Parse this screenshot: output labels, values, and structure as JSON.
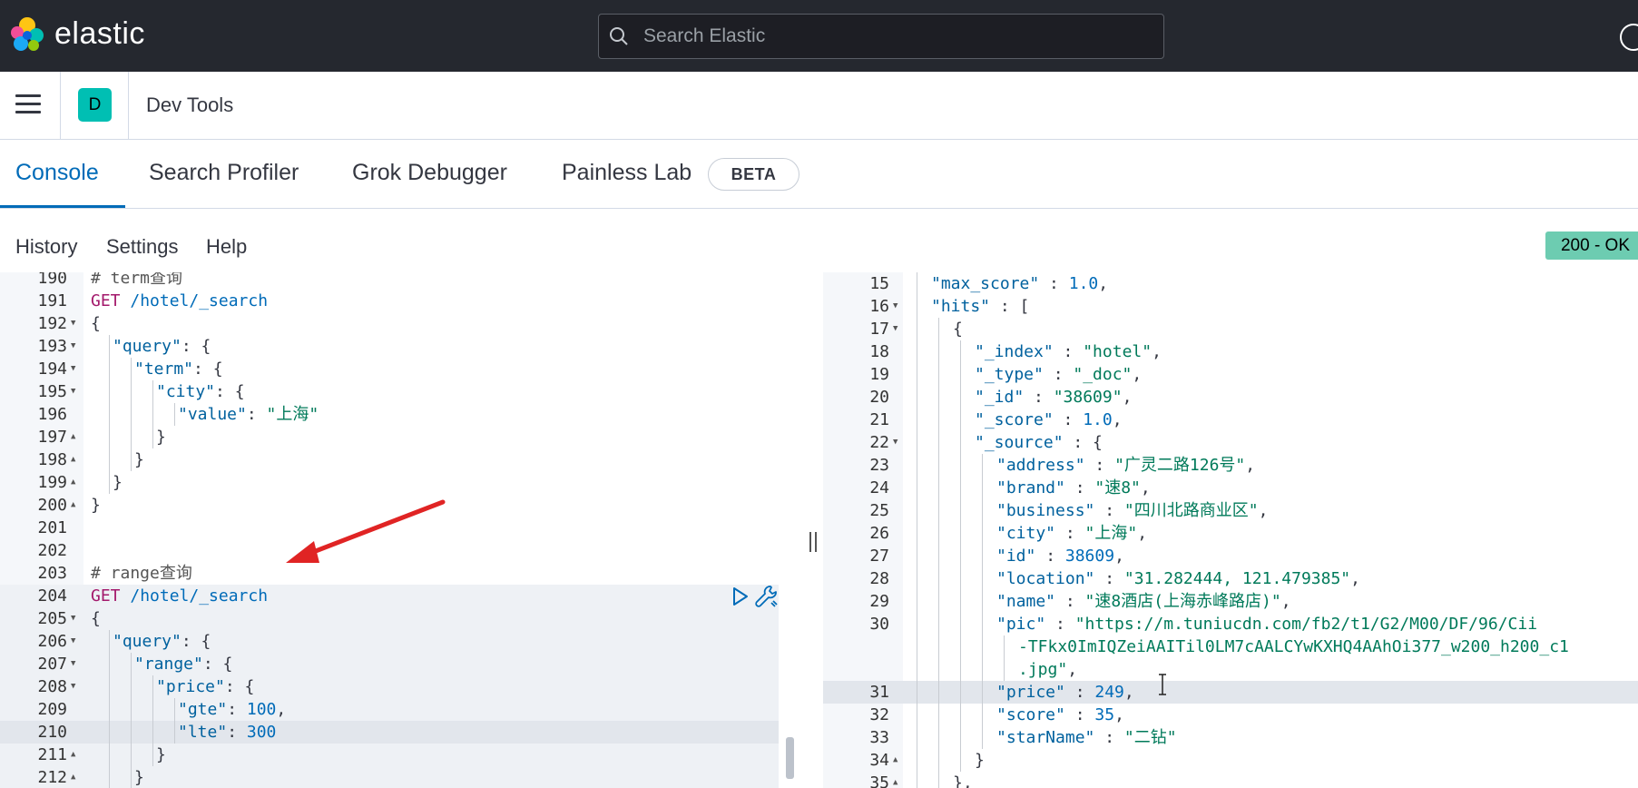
{
  "header": {
    "brand": "elastic",
    "search_placeholder": "Search Elastic",
    "icons": [
      "elastic-logo-icon",
      "search-icon",
      "help-icon"
    ]
  },
  "breadcrumb": {
    "space_initial": "D",
    "title": "Dev Tools",
    "icons": [
      "menu-icon"
    ]
  },
  "tabs": [
    {
      "label": "Console",
      "active": true
    },
    {
      "label": "Search Profiler"
    },
    {
      "label": "Grok Debugger"
    },
    {
      "label": "Painless Lab"
    }
  ],
  "beta_label": "BETA",
  "submenu": [
    "History",
    "Settings",
    "Help"
  ],
  "status": {
    "label": "200 - OK",
    "color": "#6dccb1"
  },
  "colors": {
    "accent": "#006bb8",
    "topbar": "#25282f",
    "space_avatar": "#00bfb3",
    "arrow": "#e02424"
  },
  "request_editor": {
    "lines": [
      {
        "n": "190",
        "fold": "",
        "indent": 0,
        "tokens": [
          {
            "t": "# term查询",
            "c": "comment"
          }
        ]
      },
      {
        "n": "191",
        "fold": "",
        "indent": 0,
        "tokens": [
          {
            "t": "GET",
            "c": "method"
          },
          {
            "t": " /hotel/_search",
            "c": "url"
          }
        ]
      },
      {
        "n": "192",
        "fold": "▼",
        "indent": 0,
        "tokens": [
          {
            "t": "{",
            "c": "punc"
          }
        ]
      },
      {
        "n": "193",
        "fold": "▼",
        "indent": 1,
        "tokens": [
          {
            "t": "\"query\"",
            "c": "key"
          },
          {
            "t": ": {",
            "c": "punc"
          }
        ]
      },
      {
        "n": "194",
        "fold": "▼",
        "indent": 2,
        "tokens": [
          {
            "t": "\"term\"",
            "c": "key"
          },
          {
            "t": ": {",
            "c": "punc"
          }
        ]
      },
      {
        "n": "195",
        "fold": "▼",
        "indent": 3,
        "tokens": [
          {
            "t": "\"city\"",
            "c": "key"
          },
          {
            "t": ": {",
            "c": "punc"
          }
        ]
      },
      {
        "n": "196",
        "fold": "",
        "indent": 4,
        "tokens": [
          {
            "t": "\"value\"",
            "c": "key"
          },
          {
            "t": ": ",
            "c": "punc"
          },
          {
            "t": "\"上海\"",
            "c": "str"
          }
        ]
      },
      {
        "n": "197",
        "fold": "▲",
        "indent": 3,
        "tokens": [
          {
            "t": "}",
            "c": "punc"
          }
        ]
      },
      {
        "n": "198",
        "fold": "▲",
        "indent": 2,
        "tokens": [
          {
            "t": "}",
            "c": "punc"
          }
        ]
      },
      {
        "n": "199",
        "fold": "▲",
        "indent": 1,
        "tokens": [
          {
            "t": "}",
            "c": "punc"
          }
        ]
      },
      {
        "n": "200",
        "fold": "▲",
        "indent": 0,
        "tokens": [
          {
            "t": "}",
            "c": "punc"
          }
        ]
      },
      {
        "n": "201",
        "fold": "",
        "indent": 0,
        "tokens": []
      },
      {
        "n": "202",
        "fold": "",
        "indent": 0,
        "tokens": []
      },
      {
        "n": "203",
        "fold": "",
        "indent": 0,
        "tokens": [
          {
            "t": "# range查询",
            "c": "comment"
          }
        ]
      },
      {
        "n": "204",
        "fold": "",
        "indent": 0,
        "hl": "block",
        "tokens": [
          {
            "t": "GET",
            "c": "method"
          },
          {
            "t": " /hotel/_search",
            "c": "url"
          }
        ]
      },
      {
        "n": "205",
        "fold": "▼",
        "indent": 0,
        "hl": "block",
        "tokens": [
          {
            "t": "{",
            "c": "punc"
          }
        ]
      },
      {
        "n": "206",
        "fold": "▼",
        "indent": 1,
        "hl": "block",
        "tokens": [
          {
            "t": "\"query\"",
            "c": "key"
          },
          {
            "t": ": {",
            "c": "punc"
          }
        ]
      },
      {
        "n": "207",
        "fold": "▼",
        "indent": 2,
        "hl": "block",
        "tokens": [
          {
            "t": "\"range\"",
            "c": "key"
          },
          {
            "t": ": {",
            "c": "punc"
          }
        ]
      },
      {
        "n": "208",
        "fold": "▼",
        "indent": 3,
        "hl": "block",
        "tokens": [
          {
            "t": "\"price\"",
            "c": "key"
          },
          {
            "t": ": {",
            "c": "punc"
          }
        ]
      },
      {
        "n": "209",
        "fold": "",
        "indent": 4,
        "hl": "block",
        "tokens": [
          {
            "t": "\"gte\"",
            "c": "key"
          },
          {
            "t": ": ",
            "c": "punc"
          },
          {
            "t": "100",
            "c": "num"
          },
          {
            "t": ",",
            "c": "punc"
          }
        ]
      },
      {
        "n": "210",
        "fold": "",
        "indent": 4,
        "hl": "line",
        "tokens": [
          {
            "t": "\"lte\"",
            "c": "key"
          },
          {
            "t": ": ",
            "c": "punc"
          },
          {
            "t": "300",
            "c": "num"
          }
        ]
      },
      {
        "n": "211",
        "fold": "▲",
        "indent": 3,
        "hl": "block",
        "tokens": [
          {
            "t": "}",
            "c": "punc"
          }
        ]
      },
      {
        "n": "212",
        "fold": "▲",
        "indent": 2,
        "hl": "block",
        "tokens": [
          {
            "t": "}",
            "c": "punc"
          }
        ]
      }
    ]
  },
  "response_editor": {
    "lines": [
      {
        "n": "15",
        "fold": "",
        "indent": 1,
        "tokens": [
          {
            "t": "\"max_score\"",
            "c": "key"
          },
          {
            "t": " : ",
            "c": "punc"
          },
          {
            "t": "1.0",
            "c": "num"
          },
          {
            "t": ",",
            "c": "punc"
          }
        ]
      },
      {
        "n": "16",
        "fold": "▼",
        "indent": 1,
        "tokens": [
          {
            "t": "\"hits\"",
            "c": "key"
          },
          {
            "t": " : [",
            "c": "punc"
          }
        ]
      },
      {
        "n": "17",
        "fold": "▼",
        "indent": 2,
        "tokens": [
          {
            "t": "{",
            "c": "punc"
          }
        ]
      },
      {
        "n": "18",
        "fold": "",
        "indent": 3,
        "tokens": [
          {
            "t": "\"_index\"",
            "c": "key"
          },
          {
            "t": " : ",
            "c": "punc"
          },
          {
            "t": "\"hotel\"",
            "c": "str"
          },
          {
            "t": ",",
            "c": "punc"
          }
        ]
      },
      {
        "n": "19",
        "fold": "",
        "indent": 3,
        "tokens": [
          {
            "t": "\"_type\"",
            "c": "key"
          },
          {
            "t": " : ",
            "c": "punc"
          },
          {
            "t": "\"_doc\"",
            "c": "str"
          },
          {
            "t": ",",
            "c": "punc"
          }
        ]
      },
      {
        "n": "20",
        "fold": "",
        "indent": 3,
        "tokens": [
          {
            "t": "\"_id\"",
            "c": "key"
          },
          {
            "t": " : ",
            "c": "punc"
          },
          {
            "t": "\"38609\"",
            "c": "str"
          },
          {
            "t": ",",
            "c": "punc"
          }
        ]
      },
      {
        "n": "21",
        "fold": "",
        "indent": 3,
        "tokens": [
          {
            "t": "\"_score\"",
            "c": "key"
          },
          {
            "t": " : ",
            "c": "punc"
          },
          {
            "t": "1.0",
            "c": "num"
          },
          {
            "t": ",",
            "c": "punc"
          }
        ]
      },
      {
        "n": "22",
        "fold": "▼",
        "indent": 3,
        "tokens": [
          {
            "t": "\"_source\"",
            "c": "key"
          },
          {
            "t": " : {",
            "c": "punc"
          }
        ]
      },
      {
        "n": "23",
        "fold": "",
        "indent": 4,
        "tokens": [
          {
            "t": "\"address\"",
            "c": "key"
          },
          {
            "t": " : ",
            "c": "punc"
          },
          {
            "t": "\"广灵二路126号\"",
            "c": "str"
          },
          {
            "t": ",",
            "c": "punc"
          }
        ]
      },
      {
        "n": "24",
        "fold": "",
        "indent": 4,
        "tokens": [
          {
            "t": "\"brand\"",
            "c": "key"
          },
          {
            "t": " : ",
            "c": "punc"
          },
          {
            "t": "\"速8\"",
            "c": "str"
          },
          {
            "t": ",",
            "c": "punc"
          }
        ]
      },
      {
        "n": "25",
        "fold": "",
        "indent": 4,
        "tokens": [
          {
            "t": "\"business\"",
            "c": "key"
          },
          {
            "t": " : ",
            "c": "punc"
          },
          {
            "t": "\"四川北路商业区\"",
            "c": "str"
          },
          {
            "t": ",",
            "c": "punc"
          }
        ]
      },
      {
        "n": "26",
        "fold": "",
        "indent": 4,
        "tokens": [
          {
            "t": "\"city\"",
            "c": "key"
          },
          {
            "t": " : ",
            "c": "punc"
          },
          {
            "t": "\"上海\"",
            "c": "str"
          },
          {
            "t": ",",
            "c": "punc"
          }
        ]
      },
      {
        "n": "27",
        "fold": "",
        "indent": 4,
        "tokens": [
          {
            "t": "\"id\"",
            "c": "key"
          },
          {
            "t": " : ",
            "c": "punc"
          },
          {
            "t": "38609",
            "c": "num"
          },
          {
            "t": ",",
            "c": "punc"
          }
        ]
      },
      {
        "n": "28",
        "fold": "",
        "indent": 4,
        "tokens": [
          {
            "t": "\"location\"",
            "c": "key"
          },
          {
            "t": " : ",
            "c": "punc"
          },
          {
            "t": "\"31.282444, 121.479385\"",
            "c": "str"
          },
          {
            "t": ",",
            "c": "punc"
          }
        ]
      },
      {
        "n": "29",
        "fold": "",
        "indent": 4,
        "tokens": [
          {
            "t": "\"name\"",
            "c": "key"
          },
          {
            "t": " : ",
            "c": "punc"
          },
          {
            "t": "\"速8酒店(上海赤峰路店)\"",
            "c": "str"
          },
          {
            "t": ",",
            "c": "punc"
          }
        ]
      },
      {
        "n": "30",
        "fold": "",
        "indent": 4,
        "tokens": [
          {
            "t": "\"pic\"",
            "c": "key"
          },
          {
            "t": " : ",
            "c": "punc"
          },
          {
            "t": "\"https://m.tuniucdn.com/fb2/t1/G2/M00/DF/96/Cii",
            "c": "str"
          }
        ]
      },
      {
        "n": "",
        "fold": "",
        "indent": 5,
        "tokens": [
          {
            "t": "-TFkx0ImIQZeiAAITil0LM7cAALCYwKXHQ4AAhOi377_w200_h200_c1",
            "c": "str"
          }
        ]
      },
      {
        "n": "",
        "fold": "",
        "indent": 5,
        "tokens": [
          {
            "t": ".jpg\"",
            "c": "str"
          },
          {
            "t": ",",
            "c": "punc"
          }
        ]
      },
      {
        "n": "31",
        "fold": "",
        "indent": 4,
        "hl": "line",
        "tokens": [
          {
            "t": "\"price\"",
            "c": "key"
          },
          {
            "t": " : ",
            "c": "punc"
          },
          {
            "t": "249",
            "c": "num"
          },
          {
            "t": ",",
            "c": "punc"
          }
        ]
      },
      {
        "n": "32",
        "fold": "",
        "indent": 4,
        "tokens": [
          {
            "t": "\"score\"",
            "c": "key"
          },
          {
            "t": " : ",
            "c": "punc"
          },
          {
            "t": "35",
            "c": "num"
          },
          {
            "t": ",",
            "c": "punc"
          }
        ]
      },
      {
        "n": "33",
        "fold": "",
        "indent": 4,
        "tokens": [
          {
            "t": "\"starName\"",
            "c": "key"
          },
          {
            "t": " : ",
            "c": "punc"
          },
          {
            "t": "\"二钻\"",
            "c": "str"
          }
        ]
      },
      {
        "n": "34",
        "fold": "▲",
        "indent": 3,
        "tokens": [
          {
            "t": "}",
            "c": "punc"
          }
        ]
      },
      {
        "n": "35",
        "fold": "▲",
        "indent": 2,
        "tokens": [
          {
            "t": "},",
            "c": "punc"
          }
        ]
      }
    ]
  }
}
